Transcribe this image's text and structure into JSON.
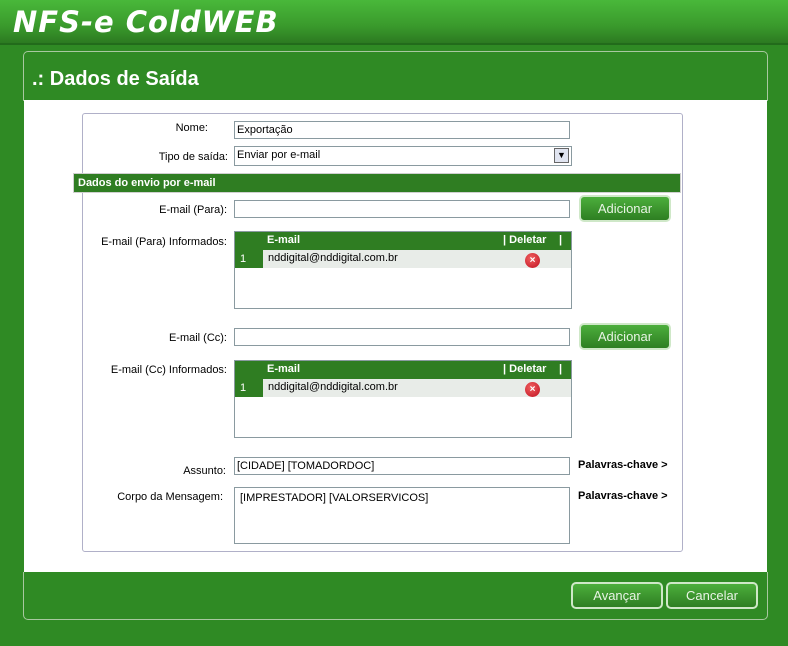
{
  "app": {
    "title": "NFS-e ColdWEB"
  },
  "page": {
    "title": ".: Dados de Saída"
  },
  "form": {
    "nome_label": "Nome:",
    "nome_value": "Exportação",
    "tipo_label": "Tipo de saída:",
    "tipo_value": "Enviar por e-mail",
    "section_title": "Dados do envio por e-mail",
    "para_label": "E-mail (Para):",
    "para_value": "",
    "para_list_label": "E-mail (Para) Informados:",
    "cc_label": "E-mail (Cc):",
    "cc_value": "",
    "cc_list_label": "E-mail (Cc) Informados:",
    "add_label": "Adicionar",
    "grid_headers": {
      "email": "E-mail",
      "delete": "| Deletar",
      "end": "|"
    },
    "para_rows": [
      {
        "num": "1",
        "email": "nddigital@nddigital.com.br"
      }
    ],
    "cc_rows": [
      {
        "num": "1",
        "email": "nddigital@nddigital.com.br"
      }
    ],
    "assunto_label": "Assunto:",
    "assunto_value": "[CIDADE] [TOMADORDOC]",
    "corpo_label": "Corpo da Mensagem:",
    "corpo_value": "[IMPRESTADOR] [VALORSERVICOS]",
    "keywords_label": "Palavras-chave >"
  },
  "footer": {
    "next": "Avançar",
    "cancel": "Cancelar"
  }
}
